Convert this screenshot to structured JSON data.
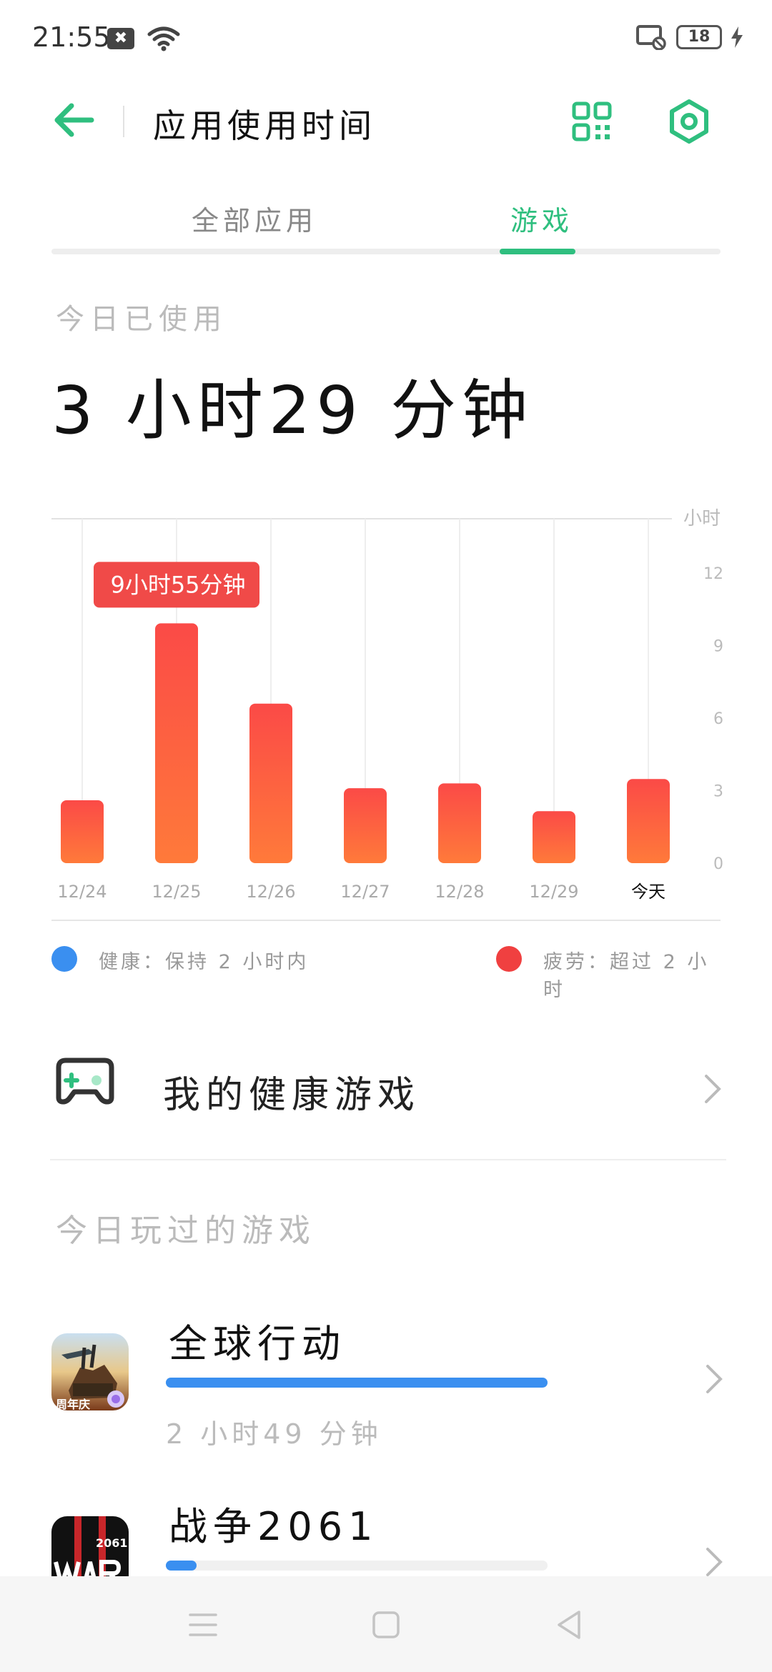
{
  "status_bar": {
    "time": "21:55",
    "notification_badge": "✖",
    "battery_level": "18"
  },
  "header": {
    "title": "应用使用时间"
  },
  "tabs": [
    {
      "label": "全部应用",
      "active": false
    },
    {
      "label": "游戏",
      "active": true
    }
  ],
  "summary": {
    "label": "今日已使用",
    "value": "3 小时29 分钟"
  },
  "chart_data": {
    "type": "bar",
    "categories": [
      "12/24",
      "12/25",
      "12/26",
      "12/27",
      "12/28",
      "12/29",
      "今天"
    ],
    "values": [
      2.6,
      9.92,
      6.6,
      3.1,
      3.3,
      2.15,
      3.48
    ],
    "ylabel": "小时",
    "yticks": [
      "0",
      "3",
      "6",
      "9",
      "12"
    ],
    "ylim": [
      0,
      12
    ],
    "highlight_index": 1,
    "tooltip": "9小时55分钟",
    "colors": {
      "bar_top": "#fb4a47",
      "bar_bottom": "#ff7a3a",
      "tooltip": "#f04a48"
    }
  },
  "legend": [
    {
      "color": "#3a8ff0",
      "text": "健康：保持 2 小时内"
    },
    {
      "color": "#f04040",
      "text": "疲劳：超过 2 小时"
    }
  ],
  "healthy_games": {
    "label": "我的健康游戏"
  },
  "played_section": {
    "label": "今日玩过的游戏"
  },
  "games": [
    {
      "name": "全球行动",
      "time": "2 小时49 分钟",
      "usage_fraction": 1.0,
      "icon": "game-icon-global-ops",
      "icon_badge": "周年庆"
    },
    {
      "name": "战争2061",
      "time": "",
      "usage_fraction": 0.08,
      "icon": "game-icon-war-2061",
      "icon_badge": "2061"
    }
  ],
  "colors": {
    "accent": "#2fbf7f",
    "bar_blue": "#3a8ff0"
  }
}
